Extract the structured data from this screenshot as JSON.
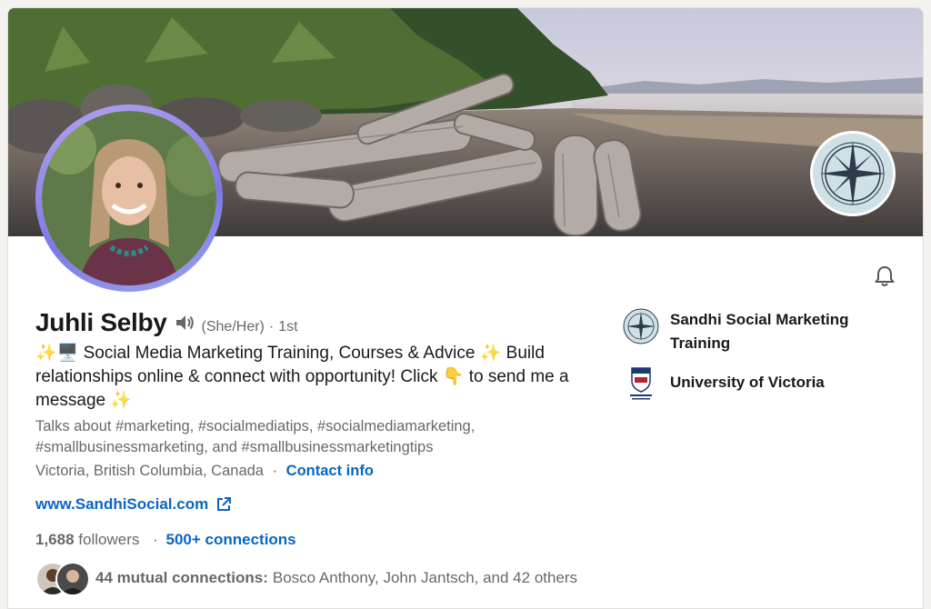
{
  "profile": {
    "name": "Juhli Selby",
    "pronouns": "(She/Her)",
    "separator": "·",
    "degree": "1st",
    "headline": "✨🖥️ Social Media Marketing Training, Courses & Advice ✨ Build relationships online & connect with opportunity! Click 👇 to send me a message ✨",
    "talks_about": "Talks about #marketing, #socialmediatips, #socialmediamarketing, #smallbusinessmarketing, and #smallbusinessmarketingtips",
    "location": "Victoria, British Columbia, Canada",
    "location_sep": "·",
    "contact_label": "Contact info",
    "website": "www.SandhiSocial.com",
    "followers_count": "1,688",
    "followers_label": " followers",
    "connections_sep": "·",
    "connections": "500+ connections",
    "mutual_label": "44 mutual connections:",
    "mutual_names": "Bosco Anthony, John Jantsch, and 42 others"
  },
  "experience": [
    {
      "name": "Sandhi Social Marketing Training",
      "icon": "compass-rose-icon"
    },
    {
      "name": "University of Victoria",
      "icon": "university-crest-icon"
    }
  ],
  "icons": {
    "speaker": "speaker-icon",
    "bell": "bell-icon",
    "external_link": "external-link-icon"
  },
  "colors": {
    "link_blue": "#0a66c2",
    "avatar_ring": "#8b7fe8",
    "muted_text": "#666666"
  }
}
